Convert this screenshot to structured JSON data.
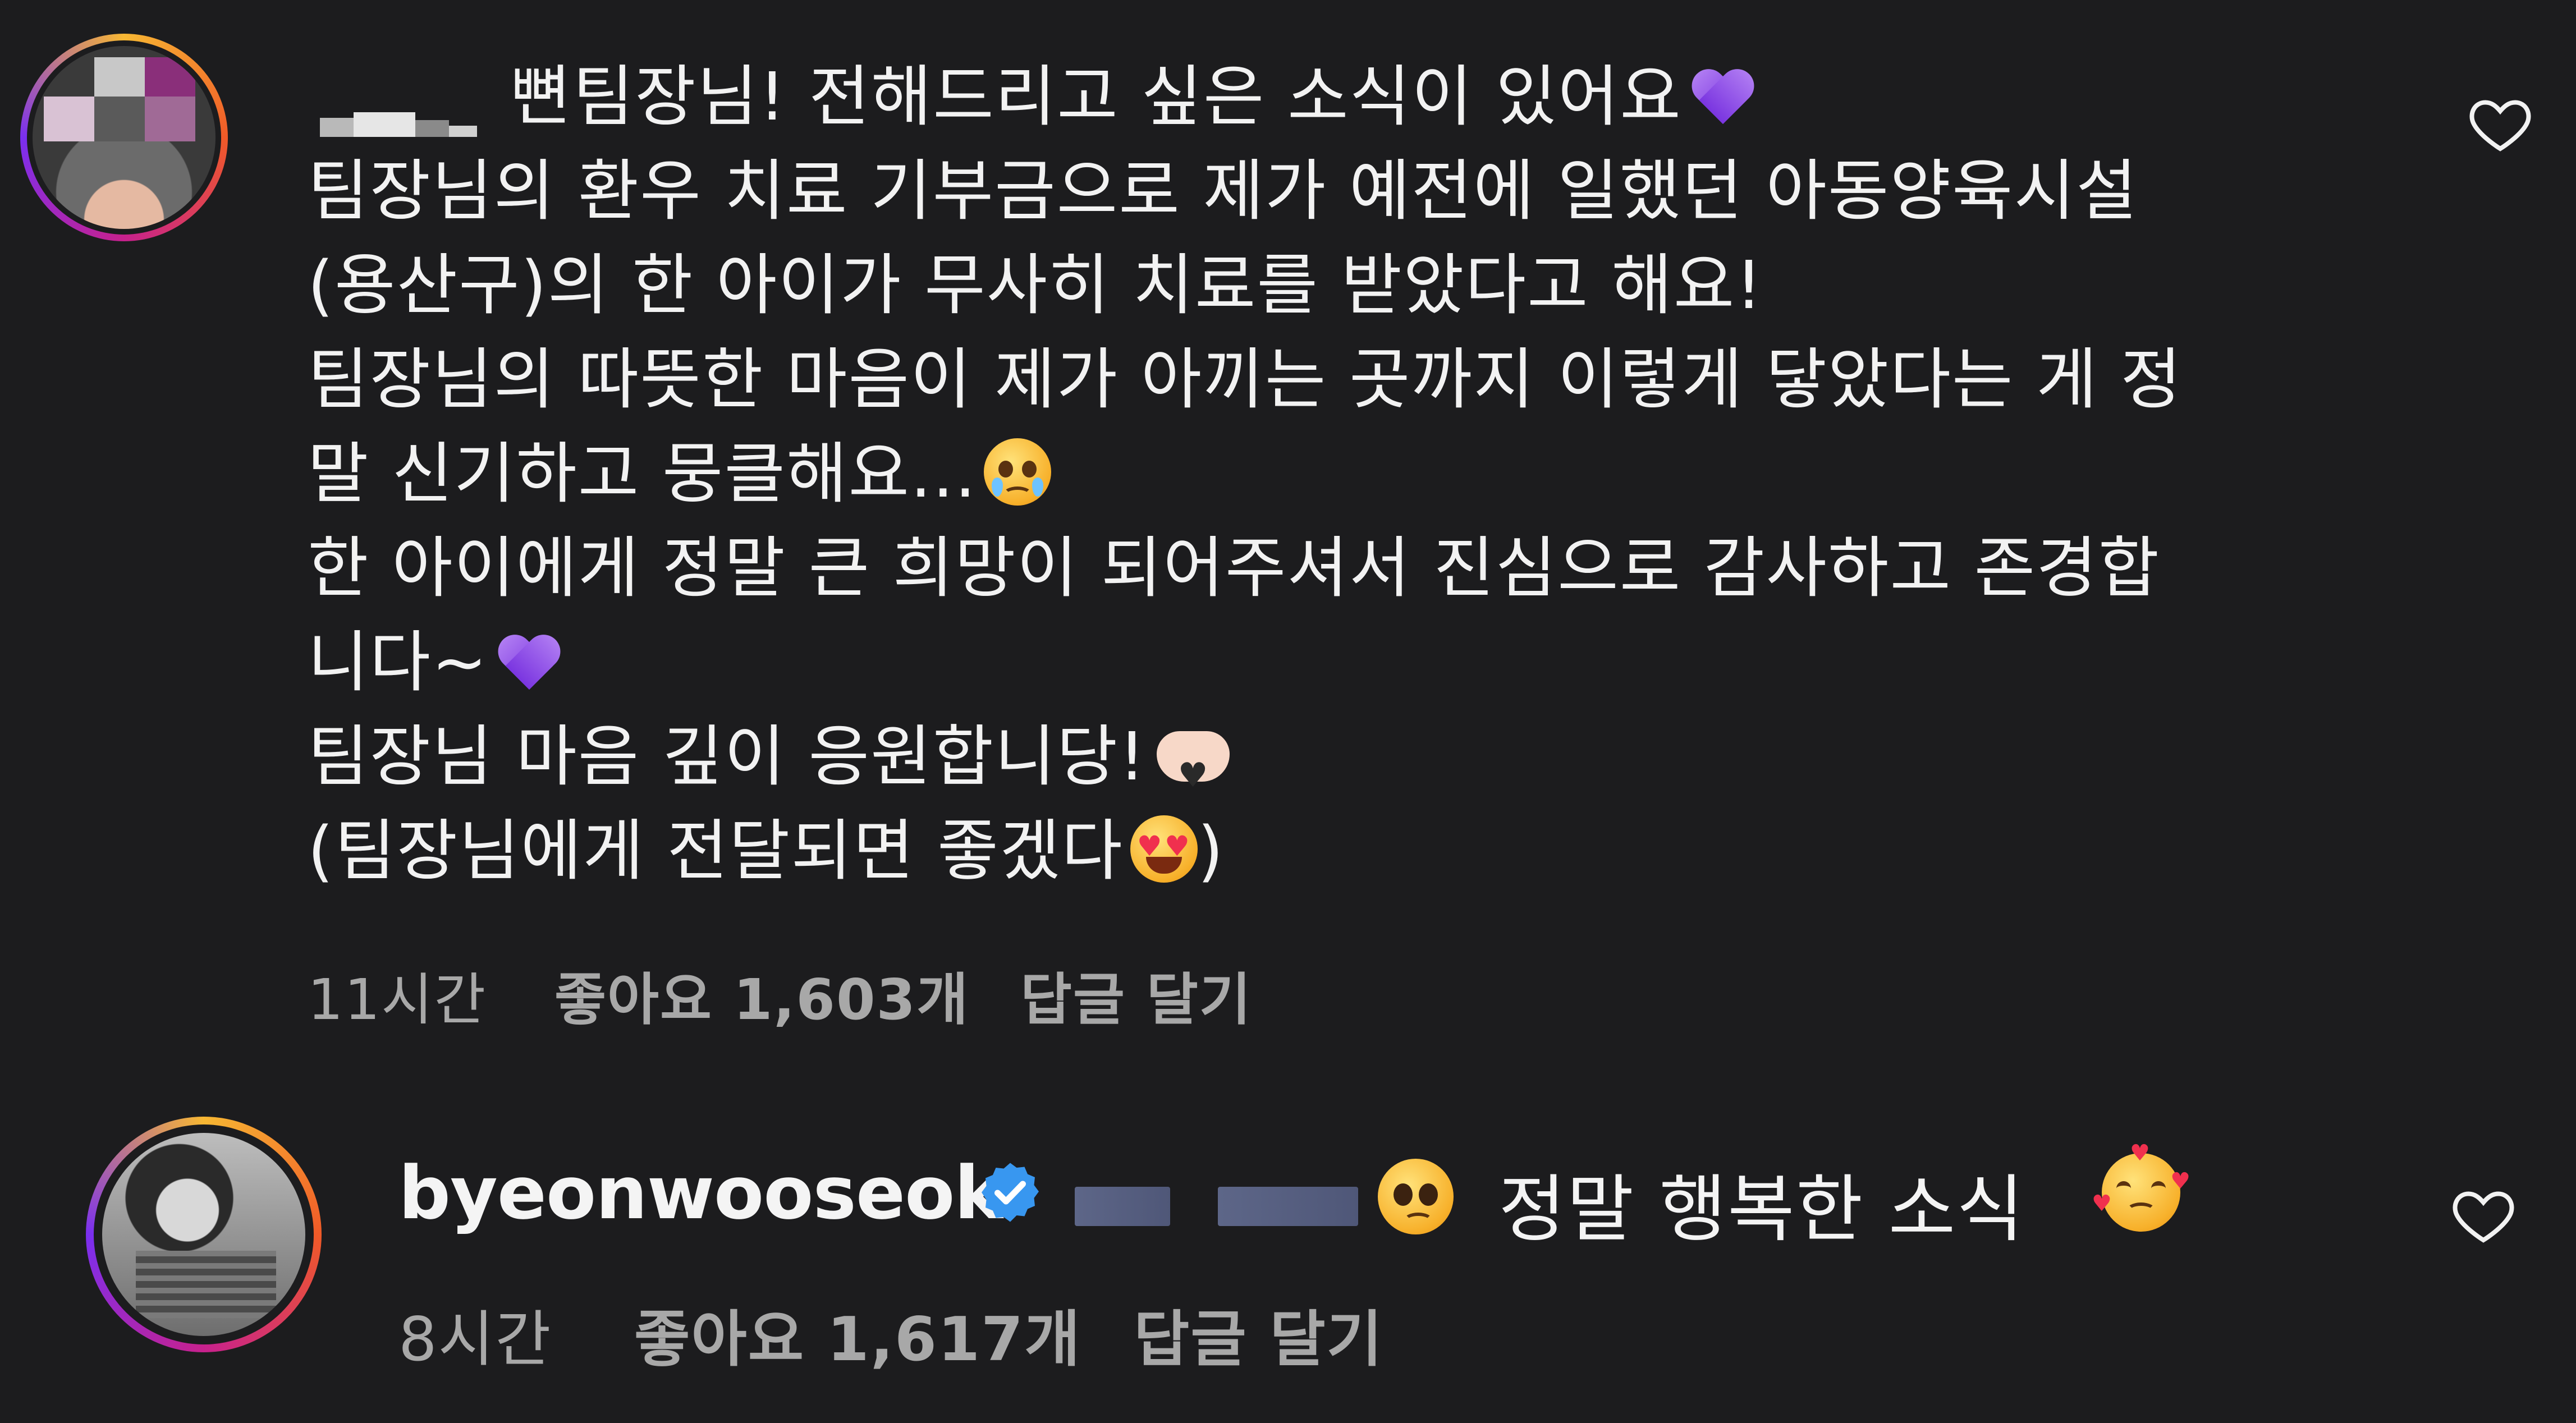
{
  "comments": [
    {
      "lines": [
        "뼌팀장님! 전해드리고 싶은 소식이 있어요",
        "팀장님의 환우 치료 기부금으로 제가 예전에 일했던 아동양육시설",
        "(용산구)의 한 아이가 무사히 치료를 받았다고 해요!",
        "팀장님의 따뜻한 마음이 제가 아끼는 곳까지 이렇게 닿았다는 게 정",
        "말 신기하고 뭉클해요...",
        "한 아이에게 정말 큰 희망이 되어주셔서 진심으로 감사하고 존경합",
        "니다~",
        "팀장님 마음 깊이 응원합니당!",
        "(팀장님에게 전달되면 좋겠다",
        ")"
      ],
      "time": "11시간",
      "likes": "좋아요 1,603개",
      "reply": "답글 달기"
    },
    {
      "username": "byeonwooseok",
      "text": "정말 행복한 소식",
      "time": "8시간",
      "likes": "좋아요 1,617개",
      "reply": "답글 달기"
    }
  ],
  "icons": {
    "like": "heart-outline-icon",
    "verified": "verified-badge-icon",
    "purple_heart": "purple-heart-emoji",
    "crying_face": "face-holding-back-tears-emoji",
    "hand_heart": "heart-hands-emoji",
    "heart_eyes": "star-struck-heart-eyes-emoji",
    "pleading_face": "pleading-face-emoji",
    "loving_face": "smiling-face-with-hearts-emoji"
  },
  "colors": {
    "background": "#1c1c1e",
    "text": "#f2f2f2",
    "meta_text": "#a8a8a8",
    "verified_blue": "#3897f0",
    "purple_heart": "#8a46e8"
  }
}
